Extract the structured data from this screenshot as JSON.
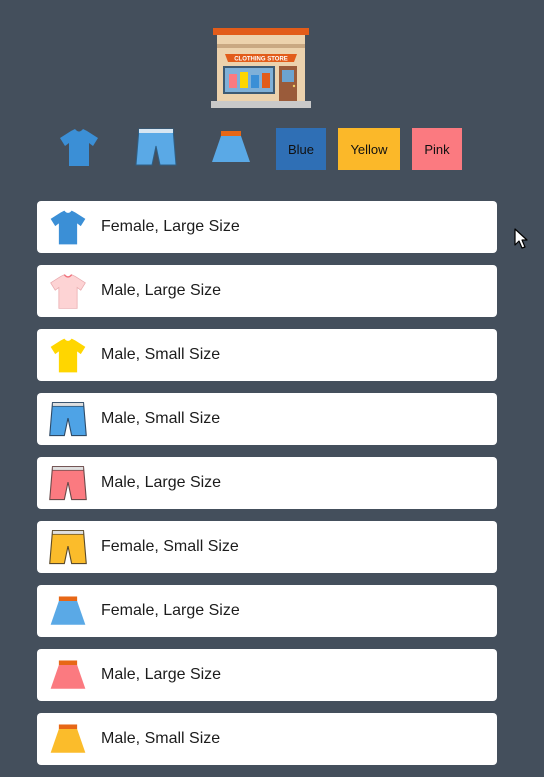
{
  "header": {
    "store_sign": "CLOTHING STORE"
  },
  "filters": {
    "icons": [
      {
        "name": "shirt-filter",
        "icon": "shirt-icon",
        "color": "#3b8fd6"
      },
      {
        "name": "shorts-filter",
        "icon": "shorts-icon",
        "color": "#5aa9e6"
      },
      {
        "name": "skirt-filter",
        "icon": "skirt-icon",
        "color": "#5aa9e6"
      }
    ],
    "colors": [
      {
        "label": "Blue",
        "color": "#2f6fb5"
      },
      {
        "label": "Yellow",
        "color": "#fbb829"
      },
      {
        "label": "Pink",
        "color": "#fb7a80"
      }
    ]
  },
  "items": [
    {
      "type": "shirt",
      "icon": "shirt-icon",
      "color": "#3b8fd6",
      "label": "Female, Large Size"
    },
    {
      "type": "shirt",
      "icon": "shirt-icon",
      "color": "#fdd3d4",
      "label": "Male, Large Size"
    },
    {
      "type": "shirt",
      "icon": "shirt-icon",
      "color": "#ffd600",
      "label": "Male, Small Size"
    },
    {
      "type": "shorts",
      "icon": "shorts-icon",
      "color": "#4ea3e6",
      "label": "Male, Small Size"
    },
    {
      "type": "shorts",
      "icon": "shorts-icon",
      "color": "#fb7a80",
      "label": "Male, Large Size"
    },
    {
      "type": "shorts",
      "icon": "shorts-icon",
      "color": "#fbbc2b",
      "label": "Female, Small Size"
    },
    {
      "type": "skirt",
      "icon": "skirt-icon",
      "color": "#5aa9e6",
      "label": "Female, Large Size"
    },
    {
      "type": "skirt",
      "icon": "skirt-icon",
      "color": "#fb7a80",
      "label": "Male, Large Size"
    },
    {
      "type": "skirt",
      "icon": "skirt-icon",
      "color": "#fbbc2b",
      "label": "Male, Small Size"
    }
  ]
}
